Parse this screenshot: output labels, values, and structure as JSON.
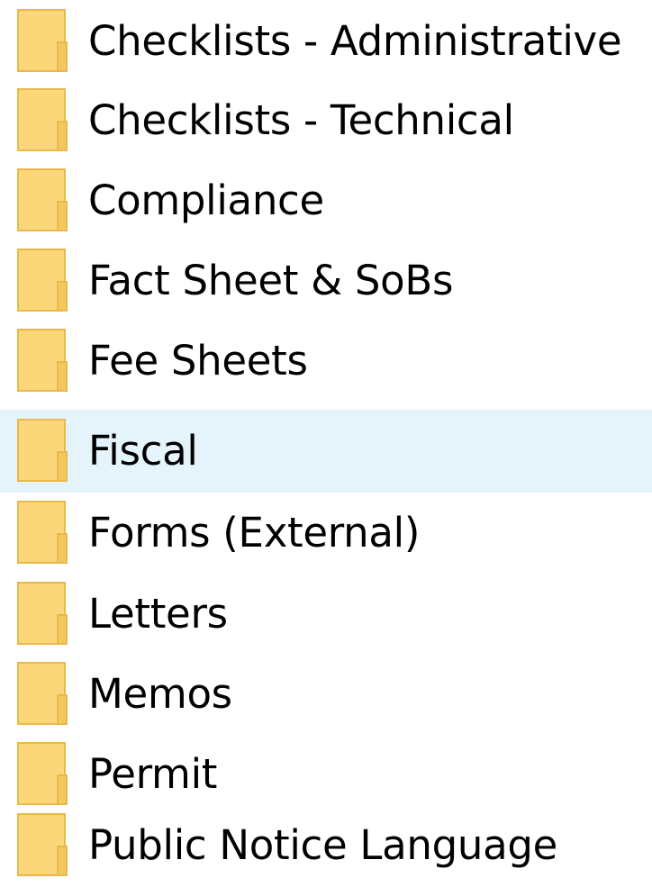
{
  "folders": [
    {
      "name": "Checklists - Administrative"
    },
    {
      "name": "Checklists - Technical"
    },
    {
      "name": "Compliance"
    },
    {
      "name": "Fact Sheet & SoBs"
    },
    {
      "name": "Fee Sheets"
    },
    {
      "name": "Fiscal"
    },
    {
      "name": "Forms (External)"
    },
    {
      "name": "Letters"
    },
    {
      "name": "Memos"
    },
    {
      "name": "Permit"
    },
    {
      "name": "Public Notice Language"
    }
  ],
  "hovered_folder": "Fiscal",
  "colors": {
    "hover_background": "#e5f3fb",
    "folder_fill": "#fcd77a",
    "folder_front": "#ffe9a1",
    "folder_edge": "#e8b94a"
  },
  "icon": "folder-icon"
}
